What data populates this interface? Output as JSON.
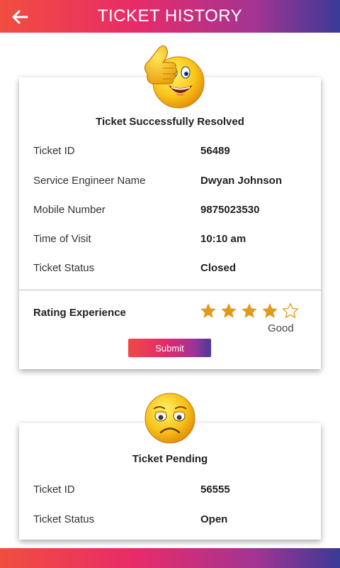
{
  "header": {
    "title": "TICKET HISTORY",
    "back_icon": "arrow-left-icon"
  },
  "colors": {
    "gradient_start": "#f04e3e",
    "gradient_mid": "#e82b6a",
    "gradient_end": "#3b3a97",
    "star": "#e09a1f"
  },
  "tickets": [
    {
      "emoji_icon": "thumbs-up-smiley-icon",
      "title": "Ticket Successfully Resolved",
      "rows": [
        {
          "label": "Ticket ID",
          "value": "56489"
        },
        {
          "label": "Service Engineer Name",
          "value": "Dwyan Johnson"
        },
        {
          "label": "Mobile Number",
          "value": "9875023530"
        },
        {
          "label": "Time of Visit",
          "value": "10:10 am"
        },
        {
          "label": "Ticket Status",
          "value": "Closed"
        }
      ],
      "rating": {
        "label": "Rating Experience",
        "stars": 4,
        "max_stars": 5,
        "text": "Good"
      },
      "submit_label": "Submit"
    },
    {
      "emoji_icon": "sad-face-icon",
      "title": "Ticket Pending",
      "rows": [
        {
          "label": "Ticket ID",
          "value": "56555"
        },
        {
          "label": "Ticket Status",
          "value": "Open"
        }
      ]
    }
  ]
}
